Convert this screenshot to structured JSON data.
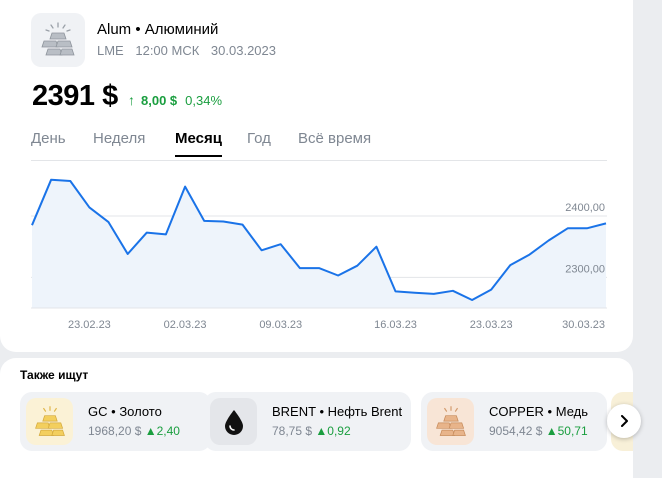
{
  "instrument": {
    "ticker": "Alum",
    "name": "Алюминий",
    "exchange": "LME",
    "time": "12:00 МСК",
    "date": "30.03.2023",
    "price": "2391 $",
    "change_abs": "8,00 $",
    "change_pct": "0,34%"
  },
  "tabs": [
    {
      "label": "День"
    },
    {
      "label": "Неделя"
    },
    {
      "label": "Месяц",
      "active": true
    },
    {
      "label": "Год"
    },
    {
      "label": "Всё время"
    }
  ],
  "colors": {
    "line": "#1a73e8",
    "area": "#eef4fb",
    "positive": "#1a9e3f"
  },
  "chart_data": {
    "type": "area",
    "y_ticks": [
      {
        "value": 2400,
        "label": "2400,00"
      },
      {
        "value": 2300,
        "label": "2300,00"
      }
    ],
    "x_ticks": [
      {
        "index": 3,
        "label": "23.02.23"
      },
      {
        "index": 8,
        "label": "02.03.23"
      },
      {
        "index": 13,
        "label": "09.03.23"
      },
      {
        "index": 19,
        "label": "16.03.23"
      },
      {
        "index": 24,
        "label": "23.03.23"
      },
      {
        "index": 28,
        "label": "30.03.23"
      }
    ],
    "values": [
      2385,
      2459,
      2457,
      2414,
      2390,
      2338,
      2373,
      2370,
      2448,
      2392,
      2391,
      2386,
      2344,
      2354,
      2315,
      2315,
      2303,
      2319,
      2350,
      2277,
      2275,
      2273,
      2278,
      2263,
      2280,
      2320,
      2337,
      2360,
      2380,
      2380,
      2388
    ],
    "ylim": [
      2250,
      2475
    ]
  },
  "also_title": "Также ищут",
  "suggestions": [
    {
      "ticker": "GC",
      "name": "Золото",
      "price": "1968,20 $",
      "change": "2,40",
      "icon": "gold-bars-icon"
    },
    {
      "ticker": "BRENT",
      "name": "Нефть Brent",
      "price": "78,75 $",
      "change": "0,92",
      "icon": "oil-drop-icon"
    },
    {
      "ticker": "COPPER",
      "name": "Медь",
      "price": "9054,42 $",
      "change": "50,71",
      "icon": "copper-bars-icon"
    }
  ],
  "sep": "•",
  "up_arrow": "↑",
  "up_triangle": "▲"
}
